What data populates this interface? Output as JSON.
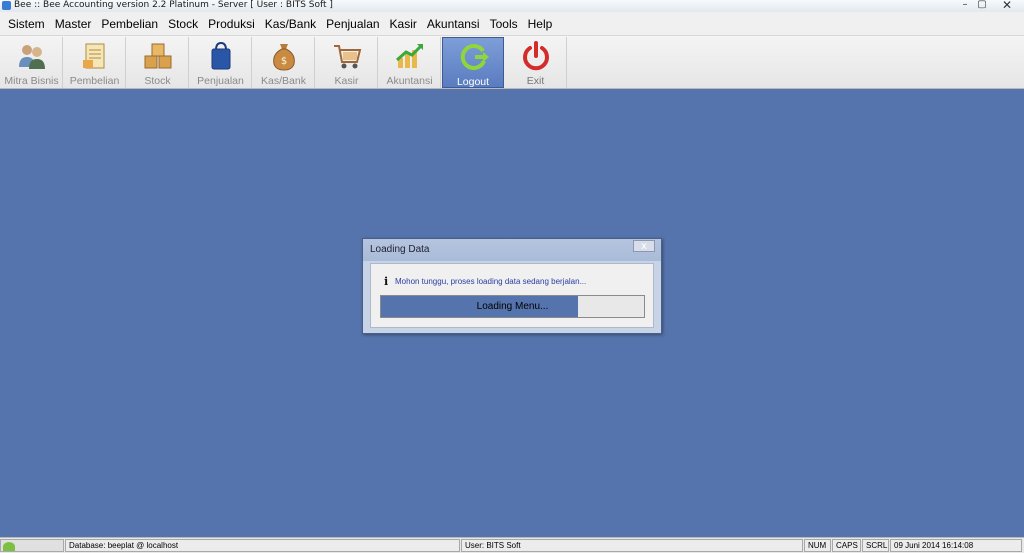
{
  "window": {
    "title": "Bee :: Bee Accounting version 2.2 Platinum - Server  [ User : BITS Soft ]",
    "controls": {
      "minimize": "–",
      "maximize": "▢",
      "close": "✕"
    }
  },
  "menu": [
    {
      "label": "Sistem"
    },
    {
      "label": "Master"
    },
    {
      "label": "Pembelian"
    },
    {
      "label": "Stock"
    },
    {
      "label": "Produksi"
    },
    {
      "label": "Kas/Bank"
    },
    {
      "label": "Penjualan"
    },
    {
      "label": "Kasir"
    },
    {
      "label": "Akuntansi"
    },
    {
      "label": "Tools"
    },
    {
      "label": "Help"
    }
  ],
  "toolbar": [
    {
      "label": "Mitra Bisnis",
      "icon": "partners-icon"
    },
    {
      "label": "Pembelian",
      "icon": "purchase-icon"
    },
    {
      "label": "Stock",
      "icon": "boxes-icon"
    },
    {
      "label": "Penjualan",
      "icon": "shopping-bag-icon"
    },
    {
      "label": "Kas/Bank",
      "icon": "money-bag-icon"
    },
    {
      "label": "Kasir",
      "icon": "cart-icon"
    },
    {
      "label": "Akuntansi",
      "icon": "chart-up-icon"
    },
    {
      "label": "Logout",
      "icon": "logout-icon"
    },
    {
      "label": "Exit",
      "icon": "power-icon"
    }
  ],
  "dialog": {
    "title": "Loading Data",
    "close": "x",
    "info_icon": "i",
    "message": "Mohon tunggu, proses loading data sedang berjalan...",
    "progress_text": "Loading Menu...",
    "progress_fraction": 0.75
  },
  "statusbar": {
    "database": "Database: beeplat @ localhost",
    "user": "User: BITS Soft",
    "num": "NUM",
    "caps": "CAPS",
    "scrl": "SCRL",
    "datetime": "09 Juni 2014   16:14:08"
  },
  "colors": {
    "workspace": "#5574ad",
    "message_text": "#2b3ea0",
    "logout_active": "#5a7cc0",
    "exit_red": "#d42b2b"
  }
}
